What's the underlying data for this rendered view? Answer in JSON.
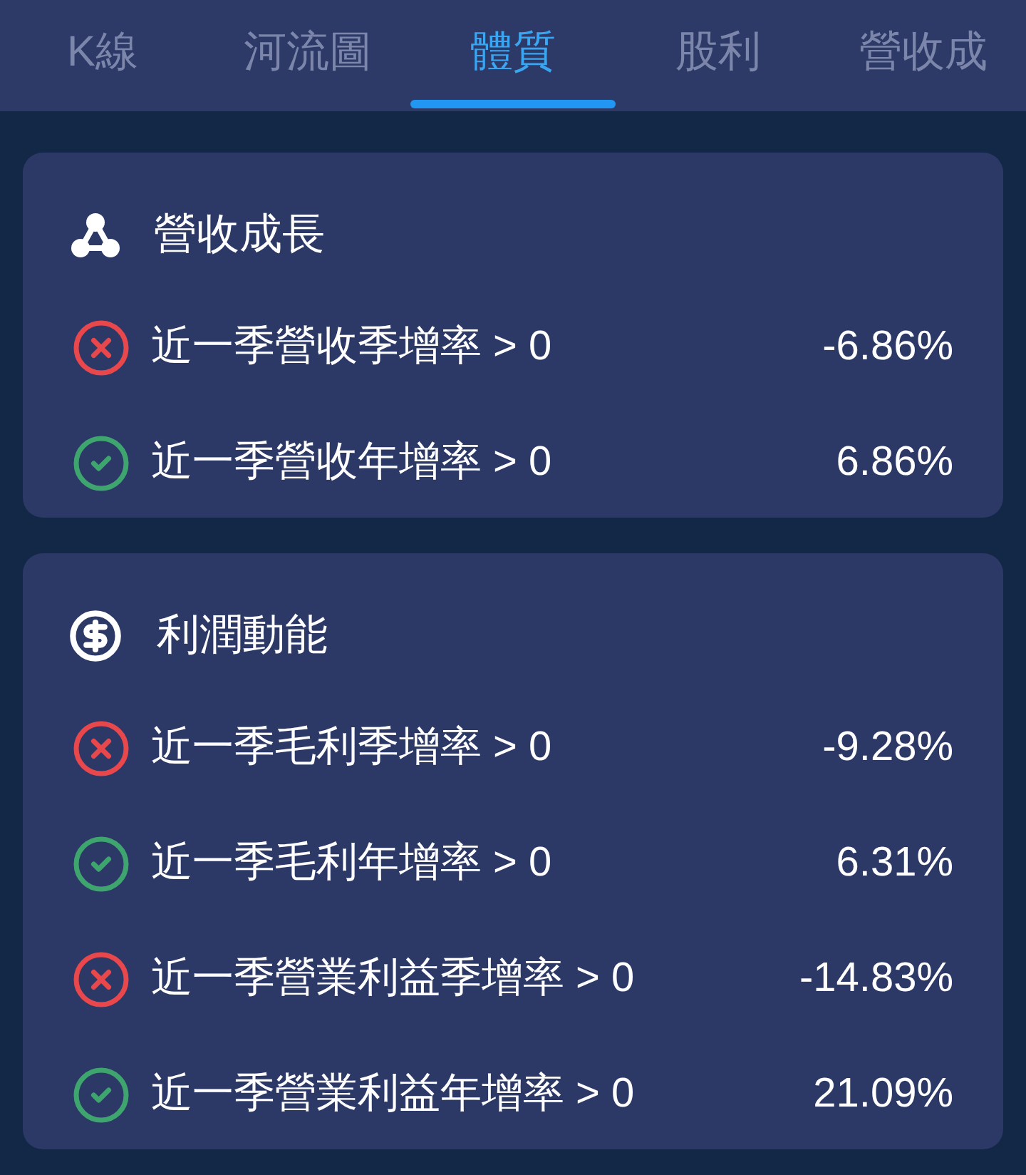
{
  "tabs": [
    {
      "label": "K線",
      "selected": false
    },
    {
      "label": "河流圖",
      "selected": false
    },
    {
      "label": "體質",
      "selected": true
    },
    {
      "label": "股利",
      "selected": false
    },
    {
      "label": "營收成",
      "selected": false
    }
  ],
  "sections": [
    {
      "title": "營收成長",
      "items": [
        {
          "label": "近一季營收季增率 > 0",
          "passed": false,
          "value": "-6.86%"
        },
        {
          "label": "近一季營收年增率 > 0",
          "passed": true,
          "value": "6.86%"
        }
      ]
    },
    {
      "title": "利潤動能",
      "items": [
        {
          "label": "近一季毛利季增率 > 0",
          "passed": false,
          "value": "-9.28%"
        },
        {
          "label": "近一季毛利年增率 > 0",
          "passed": true,
          "value": "6.31%"
        },
        {
          "label": "近一季營業利益季增率 > 0",
          "passed": false,
          "value": "-14.83%"
        },
        {
          "label": "近一季營業利益年增率 > 0",
          "passed": true,
          "value": "21.09%"
        }
      ]
    }
  ]
}
